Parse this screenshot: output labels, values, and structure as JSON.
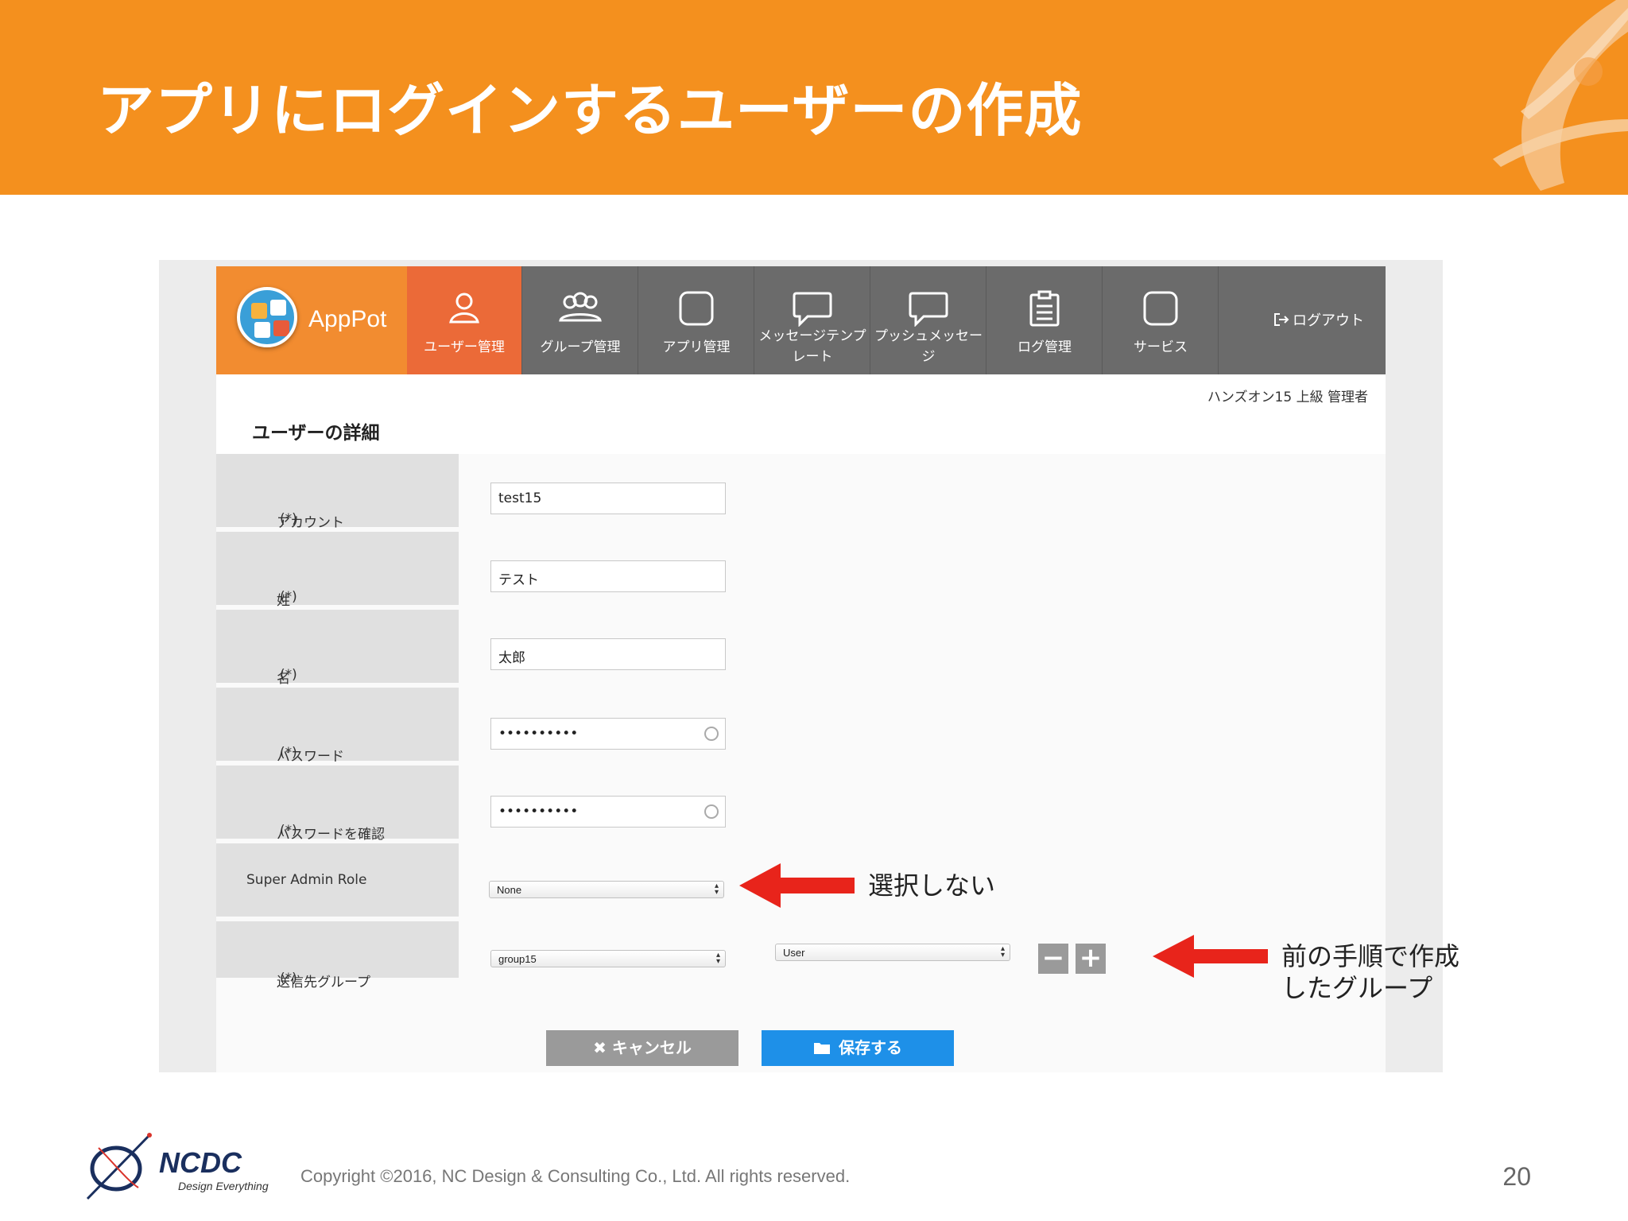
{
  "slide": {
    "title": "アプリにログインするユーザーの作成",
    "page_number": "20",
    "copyright": "Copyright ©2016, NC Design & Consulting Co., Ltd. All rights reserved.",
    "footer_brand": "NCDC",
    "footer_tagline": "Design Everything",
    "colors": {
      "banner": "#f4901e",
      "annotation_arrow": "#e8241b"
    }
  },
  "app": {
    "brand": "AppPot",
    "nav": [
      {
        "label": "ユーザー管理",
        "icon": "user-icon",
        "active": true
      },
      {
        "label": "グループ管理",
        "icon": "users-icon",
        "active": false
      },
      {
        "label": "アプリ管理",
        "icon": "app-square-icon",
        "active": false
      },
      {
        "label": "メッセージテンプ",
        "label2": "レート",
        "icon": "chat-bubble-icon",
        "active": false
      },
      {
        "label": "プッシュメッセー",
        "label2": "ジ",
        "icon": "chat-bubble-icon",
        "active": false
      },
      {
        "label": "ログ管理",
        "icon": "clipboard-icon",
        "active": false
      },
      {
        "label": "サービス",
        "icon": "service-square-icon",
        "active": false
      }
    ],
    "logout": "ログアウト",
    "user_info": "ハンズオン15 上級 管理者",
    "page_heading": "ユーザーの詳細",
    "required_mark": "(*)",
    "fields": {
      "account": {
        "label": "アカウント",
        "value": "test15"
      },
      "last_name": {
        "label": "姓",
        "value": "テスト"
      },
      "first_name": {
        "label": "名",
        "value": "太郎"
      },
      "password": {
        "label": "パスワード",
        "value": "••••••••••"
      },
      "password_confirm": {
        "label": "パスワードを確認",
        "value": "••••••••••"
      },
      "super_admin_role": {
        "label": "Super Admin Role",
        "value": "None"
      },
      "group": {
        "label": "送信先グループ",
        "value": "group15",
        "role_value": "User"
      }
    },
    "buttons": {
      "minus": "−",
      "plus": "+",
      "cancel": "キャンセル",
      "save": "保存する"
    }
  },
  "annotations": {
    "role_note": "選択しない",
    "group_note_line1": "前の手順で作成",
    "group_note_line2": "したグループ"
  }
}
